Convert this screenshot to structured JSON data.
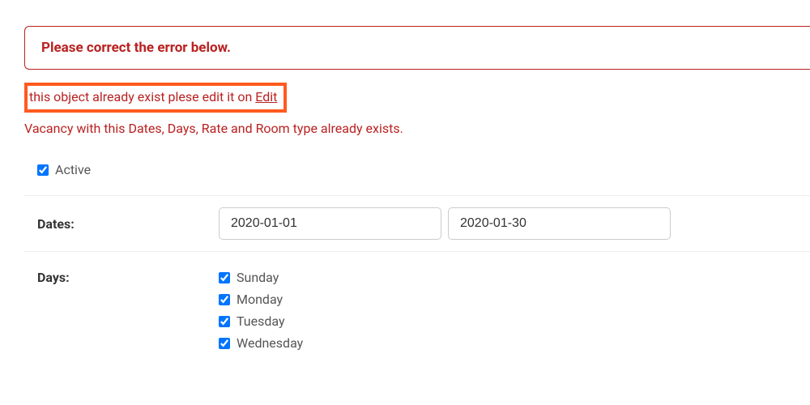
{
  "error_banner": "Please correct the error below.",
  "error_inline_prefix": "this object already exist plese edit it on ",
  "error_inline_link": "Edit",
  "error_validation": "Vacancy with this Dates, Days, Rate and Room type already exists.",
  "active": {
    "label": "Active",
    "checked": true
  },
  "dates": {
    "label": "Dates:",
    "start": "2020-01-01",
    "end": "2020-01-30"
  },
  "days": {
    "label": "Days:",
    "items": [
      {
        "label": "Sunday",
        "checked": true
      },
      {
        "label": "Monday",
        "checked": true
      },
      {
        "label": "Tuesday",
        "checked": true
      },
      {
        "label": "Wednesday",
        "checked": true
      }
    ]
  }
}
